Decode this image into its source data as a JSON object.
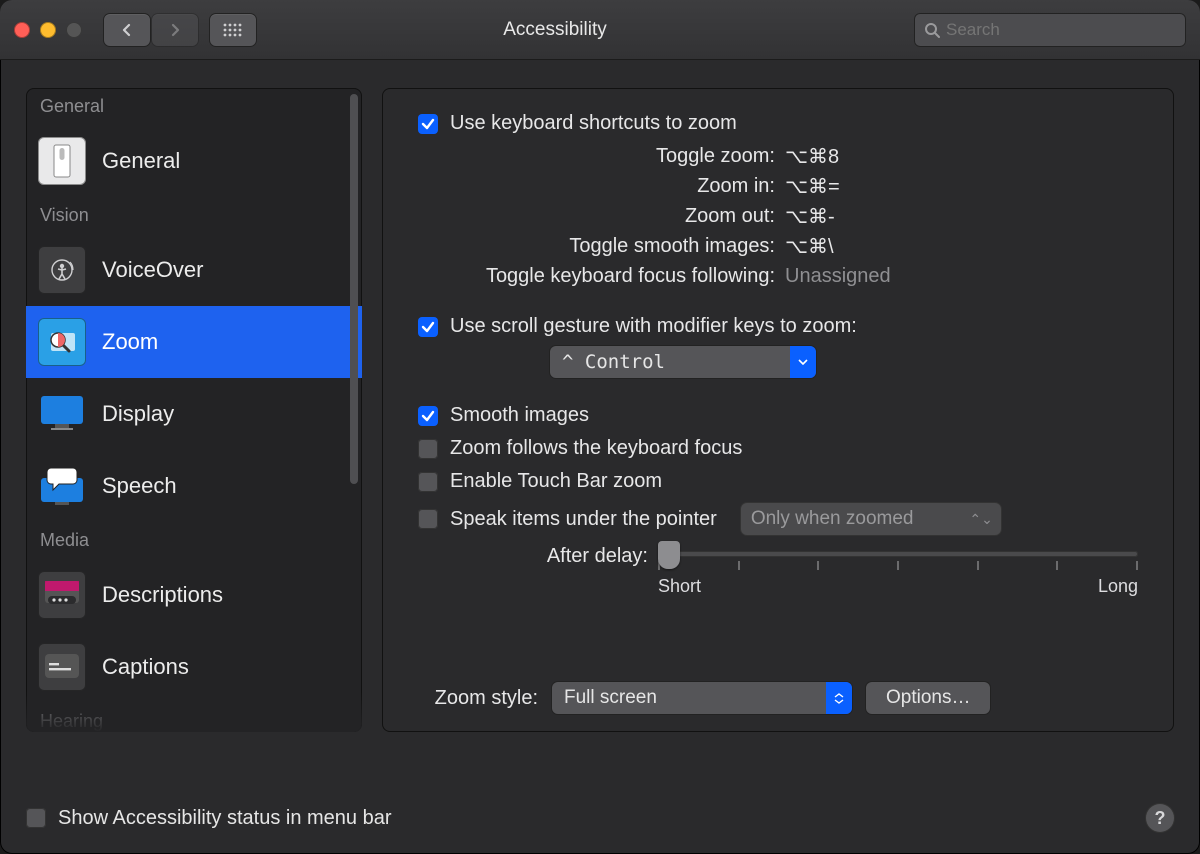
{
  "window": {
    "title": "Accessibility"
  },
  "search": {
    "placeholder": "Search"
  },
  "sidebar": {
    "sections": [
      {
        "header": "General",
        "items": [
          {
            "label": "General"
          }
        ]
      },
      {
        "header": "Vision",
        "items": [
          {
            "label": "VoiceOver"
          },
          {
            "label": "Zoom",
            "selected": true
          },
          {
            "label": "Display"
          },
          {
            "label": "Speech"
          }
        ]
      },
      {
        "header": "Media",
        "items": [
          {
            "label": "Descriptions"
          },
          {
            "label": "Captions"
          }
        ]
      },
      {
        "header": "Hearing",
        "items": []
      }
    ]
  },
  "panel": {
    "use_shortcuts": {
      "checked": true,
      "label": "Use keyboard shortcuts to zoom"
    },
    "shortcuts": [
      {
        "label": "Toggle zoom:",
        "value": "⌥⌘8"
      },
      {
        "label": "Zoom in:",
        "value": "⌥⌘="
      },
      {
        "label": "Zoom out:",
        "value": "⌥⌘-"
      },
      {
        "label": "Toggle smooth images:",
        "value": "⌥⌘\\"
      },
      {
        "label": "Toggle keyboard focus following:",
        "value": "Unassigned",
        "dim": true
      }
    ],
    "scroll_mod": {
      "checked": true,
      "label": "Use scroll gesture with modifier keys to zoom:",
      "value": "^ Control"
    },
    "smooth": {
      "checked": true,
      "label": "Smooth images"
    },
    "follows": {
      "checked": false,
      "label": "Zoom follows the keyboard focus"
    },
    "touchbar": {
      "checked": false,
      "label": "Enable Touch Bar zoom"
    },
    "speak": {
      "checked": false,
      "label": "Speak items under the pointer",
      "mode": "Only when zoomed"
    },
    "delay": {
      "label": "After delay:",
      "min_label": "Short",
      "max_label": "Long"
    },
    "zoom_style": {
      "label": "Zoom style:",
      "value": "Full screen"
    },
    "options_btn": "Options…"
  },
  "footer": {
    "show_status": {
      "checked": false,
      "label": "Show Accessibility status in menu bar"
    }
  }
}
